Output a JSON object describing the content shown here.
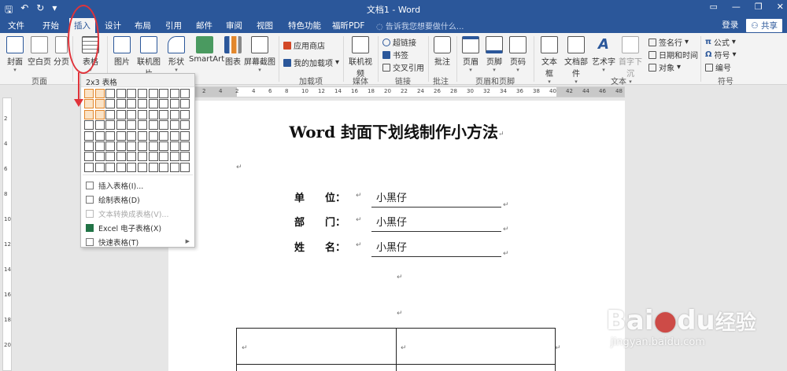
{
  "window": {
    "title": "文档1 - Word",
    "quick_access": [
      "save-icon",
      "undo-icon",
      "redo-icon",
      "customize-icon"
    ]
  },
  "tabs": {
    "items": [
      "文件",
      "开始",
      "插入",
      "设计",
      "布局",
      "引用",
      "邮件",
      "审阅",
      "视图",
      "特色功能",
      "福昕PDF"
    ],
    "active": "插入",
    "tell_me": "告诉我您想要做什么...",
    "login": "登录",
    "share": "共享"
  },
  "ribbon": {
    "pages": {
      "cover": "封面",
      "blank": "空白页",
      "break": "分页",
      "group": "页面"
    },
    "table": {
      "label": "表格"
    },
    "illustrations": {
      "picture": "图片",
      "online_picture": "联机图片",
      "shapes": "形状",
      "smartart": "SmartArt",
      "chart": "图表",
      "screenshot": "屏幕截图"
    },
    "addins": {
      "store": "应用商店",
      "my_addins": "我的加载项",
      "group": "加载项"
    },
    "media": {
      "online_video": "联机视频",
      "group": "媒体"
    },
    "links": {
      "hyperlink": "超链接",
      "bookmark": "书签",
      "crossref": "交叉引用",
      "group": "链接"
    },
    "comments": {
      "comment": "批注",
      "group": "批注"
    },
    "header_footer": {
      "header": "页眉",
      "footer": "页脚",
      "page_number": "页码",
      "group": "页眉和页脚"
    },
    "text": {
      "textbox": "文本框",
      "quickparts": "文档部件",
      "wordart": "艺术字",
      "dropcap": "首字下沉",
      "signature": "签名行",
      "datetime": "日期和时间",
      "object": "对象",
      "group": "文本"
    },
    "symbols": {
      "equation": "公式",
      "symbol": "符号",
      "number": "编号",
      "group": "符号"
    }
  },
  "table_menu": {
    "header": "2x3 表格",
    "grid": {
      "cols": 10,
      "rows": 8,
      "selected_cols": 2,
      "selected_rows": 3
    },
    "items": [
      {
        "label": "插入表格(I)...",
        "disabled": false
      },
      {
        "label": "绘制表格(D)",
        "disabled": false
      },
      {
        "label": "文本转换成表格(V)...",
        "disabled": true
      },
      {
        "label": "Excel 电子表格(X)",
        "disabled": false
      },
      {
        "label": "快速表格(T)",
        "disabled": false
      }
    ]
  },
  "ruler": {
    "h_numbers": [
      "2",
      "4",
      "2",
      "4",
      "6",
      "8",
      "10",
      "12",
      "14",
      "16",
      "18",
      "20",
      "22",
      "24",
      "26",
      "28",
      "30",
      "32",
      "34",
      "36",
      "38",
      "40",
      "42",
      "44",
      "46",
      "48"
    ],
    "v_numbers": [
      "2",
      "4",
      "6",
      "8",
      "10",
      "12",
      "14",
      "16",
      "18",
      "20"
    ]
  },
  "document": {
    "title": "Word 封面下划线制作小方法",
    "paragraph_mark": "↵",
    "fields": [
      {
        "label": "单　　位：",
        "value": "小黑仔"
      },
      {
        "label": "部　　门：",
        "value": "小黑仔"
      },
      {
        "label": "姓　　名：",
        "value": "小黑仔"
      }
    ]
  },
  "colors": {
    "accent": "#2b579a",
    "annotation": "#e0333a",
    "grid_selected": "#e2872c"
  },
  "watermark": {
    "brand": "Bai",
    "paw": "du",
    "brand_cn": "经验",
    "url": "jingyan.baidu.com"
  }
}
